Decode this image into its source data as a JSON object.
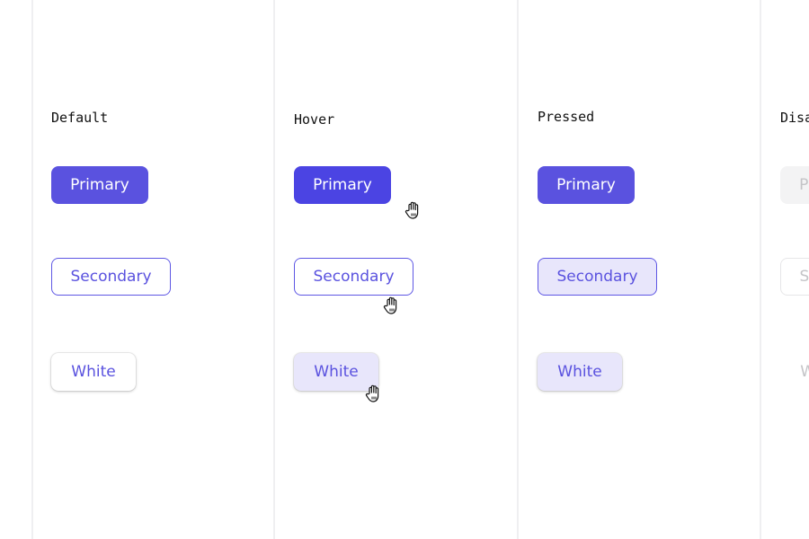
{
  "colors": {
    "primary_default": "#5a52df",
    "primary_hover": "#4b44e3",
    "primary_pressed": "#5a52df",
    "accent_text": "#5a52df",
    "secondary_border": "#5e57e4",
    "pressed_fill": "#e8e6fb",
    "hover_white_fill": "#e8e6fb",
    "disabled_fill": "#f3f3f4",
    "disabled_text": "#c4c4c7",
    "disabled_border": "#e6e6e8"
  },
  "columns": [
    {
      "state": "Default",
      "buttons": {
        "primary": "Primary",
        "secondary": "Secondary",
        "white": "White"
      }
    },
    {
      "state": "Hover",
      "buttons": {
        "primary": "Primary",
        "secondary": "Secondary",
        "white": "White"
      },
      "cursor_icon": "hand-pointer-icon"
    },
    {
      "state": "Pressed",
      "buttons": {
        "primary": "Primary",
        "secondary": "Secondary",
        "white": "White"
      }
    },
    {
      "state": "Disabled",
      "buttons": {
        "primary": "Primary",
        "secondary": "Secondary",
        "white": "White"
      }
    }
  ]
}
